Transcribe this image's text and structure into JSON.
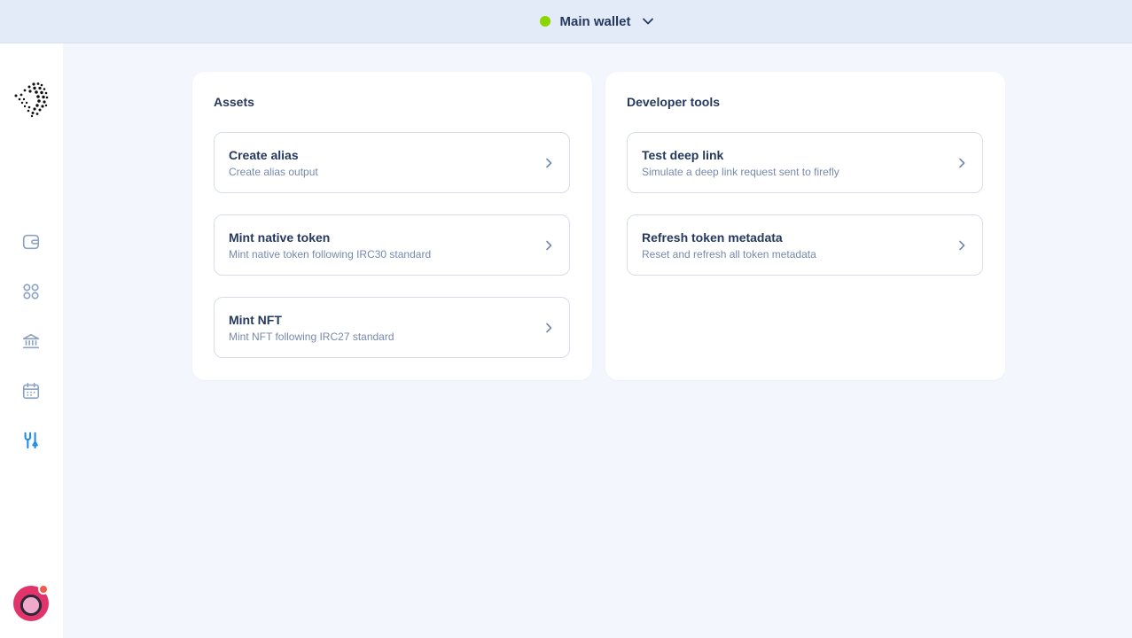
{
  "header": {
    "wallet_name": "Main wallet",
    "wallet_status_color": "#8cd500",
    "dropdown_icon": "chevron-down-icon"
  },
  "sidebar": {
    "logo": "iota-logo",
    "items": [
      {
        "name": "wallet",
        "icon": "wallet-icon",
        "active": false
      },
      {
        "name": "collectibles",
        "icon": "grid-icon",
        "active": false
      },
      {
        "name": "governance",
        "icon": "bank-icon",
        "active": false
      },
      {
        "name": "staking",
        "icon": "calendar-icon",
        "active": false
      },
      {
        "name": "developer",
        "icon": "tools-icon",
        "active": true
      }
    ],
    "active_color": "#1b8ae0",
    "inactive_color": "#8ea3c4",
    "avatar_has_notification": true,
    "notification_color": "#f25a4c"
  },
  "panels": [
    {
      "title": "Assets",
      "items": [
        {
          "title": "Create alias",
          "description": "Create alias output"
        },
        {
          "title": "Mint native token",
          "description": "Mint native token following IRC30 standard"
        },
        {
          "title": "Mint NFT",
          "description": "Mint NFT following IRC27 standard"
        }
      ]
    },
    {
      "title": "Developer tools",
      "items": [
        {
          "title": "Test deep link",
          "description": "Simulate a deep link request sent to firefly"
        },
        {
          "title": "Refresh token metadata",
          "description": "Reset and refresh all token metadata"
        }
      ]
    }
  ]
}
